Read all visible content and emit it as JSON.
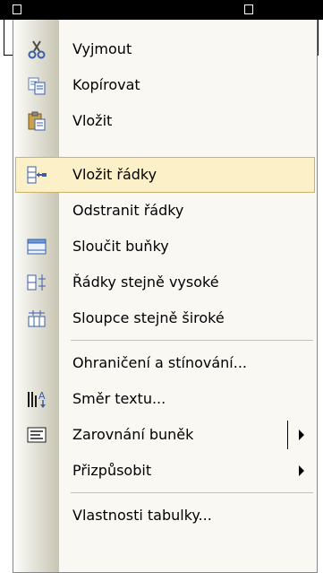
{
  "menu": {
    "items": [
      {
        "label": "Vyjmout",
        "icon": "scissors-icon"
      },
      {
        "label": "Kopírovat",
        "icon": "copy-icon"
      },
      {
        "label": "Vložit",
        "icon": "paste-icon"
      },
      {
        "label": "Vložit řádky",
        "icon": "insert-rows-icon",
        "highlighted": true
      },
      {
        "label": "Odstranit řádky"
      },
      {
        "label": "Sloučit buňky",
        "icon": "merge-cells-icon"
      },
      {
        "label": "Řádky stejně vysoké",
        "icon": "distribute-rows-icon"
      },
      {
        "label": "Sloupce stejně široké",
        "icon": "distribute-columns-icon"
      },
      {
        "label": "Ohraničení a stínování..."
      },
      {
        "label": "Směr textu...",
        "icon": "text-direction-icon"
      },
      {
        "label": "Zarovnání buněk",
        "icon": "cell-alignment-icon",
        "submenu": true,
        "split": true
      },
      {
        "label": "Přizpůsobit",
        "submenu": true
      },
      {
        "label": "Vlastnosti tabulky..."
      }
    ]
  },
  "colors": {
    "menu_background": "#f9f8f3",
    "highlight_background": "#fbf0c7",
    "highlight_border": "#c7b36b",
    "gutter_dark": "#c8c5b2"
  }
}
